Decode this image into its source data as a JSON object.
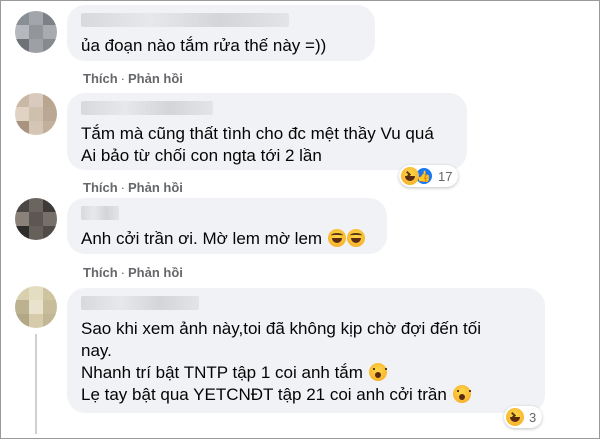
{
  "colors": {
    "bubble_bg": "#f0f2f5",
    "action_text": "#65676b",
    "text": "#050505",
    "like_blue": "#1877f2",
    "haha_yellow": "#f5c33b"
  },
  "comments": [
    {
      "lines": [
        "ủa đoạn nào tắm rửa thế này =))"
      ],
      "actions": {
        "like": "Thích",
        "reply": "Phản hồi",
        "separator": "·"
      },
      "reactions": null
    },
    {
      "lines": [
        "Tắm mà cũng thất tình cho đc mệt thầy Vu quá",
        "Ai bảo từ chối con ngta tới 2 lần"
      ],
      "actions": {
        "like": "Thích",
        "reply": "Phản hồi",
        "separator": "·"
      },
      "reactions": {
        "icons": [
          "haha-icon",
          "like-icon"
        ],
        "count": "17"
      }
    },
    {
      "lines": [
        "Anh cởi trần ơi. Mờ lem mờ lem"
      ],
      "actions": {
        "like": "Thích",
        "reply": "Phản hồi",
        "separator": "·"
      },
      "reactions": null
    },
    {
      "lines": [
        "Sao khi xem ảnh này,toi đã không kịp chờ đợi đến tối",
        "nay.",
        "Nhanh trí bật TNTP tập 1 coi anh tắm",
        "Lẹ tay bật qua YETCNĐT tập 21 coi anh cởi trần"
      ],
      "actions": {
        "like": "Thích",
        "reply": "Phản hồi",
        "separator": "·"
      },
      "reactions": {
        "icons": [
          "haha-icon"
        ],
        "count": "3"
      }
    }
  ]
}
